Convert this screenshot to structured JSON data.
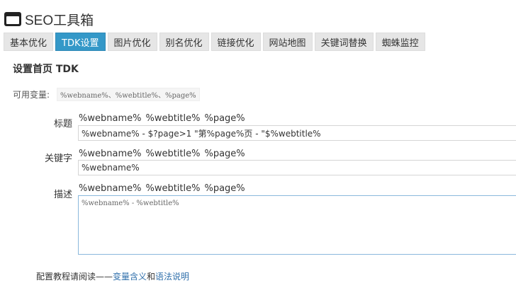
{
  "app": {
    "title": "SEO工具箱",
    "icon": "browser-window-icon"
  },
  "tabs": [
    {
      "label": "基本优化",
      "active": false
    },
    {
      "label": "TDK设置",
      "active": true
    },
    {
      "label": "图片优化",
      "active": false
    },
    {
      "label": "别名优化",
      "active": false
    },
    {
      "label": "链接优化",
      "active": false
    },
    {
      "label": "网站地图",
      "active": false
    },
    {
      "label": "关键词替换",
      "active": false
    },
    {
      "label": "蜘蛛监控",
      "active": false
    }
  ],
  "section": {
    "title": "设置首页 TDK"
  },
  "available_vars": {
    "label": "可用变量:",
    "value": "%webname%、%webtitle%、%page%"
  },
  "fields": {
    "title": {
      "label": "标题",
      "chips": [
        "%webname%",
        "%webtitle%",
        "%page%"
      ],
      "value": "%webname% - $?page>1 \"第%page%页 - \"$%webtitle%"
    },
    "keywords": {
      "label": "关键字",
      "chips": [
        "%webname%",
        "%webtitle%",
        "%page%"
      ],
      "value": "%webname%"
    },
    "description": {
      "label": "描述",
      "chips": [
        "%webname%",
        "%webtitle%",
        "%page%"
      ],
      "value": "%webname% - %webtitle%"
    }
  },
  "footer": {
    "prefix": "配置教程请阅读——",
    "link1": "变量含义",
    "middle": "和",
    "link2": "语法说明"
  },
  "colors": {
    "accent": "#3498c8",
    "link": "#2f6fab",
    "tab_bg": "#e6e6e6"
  }
}
